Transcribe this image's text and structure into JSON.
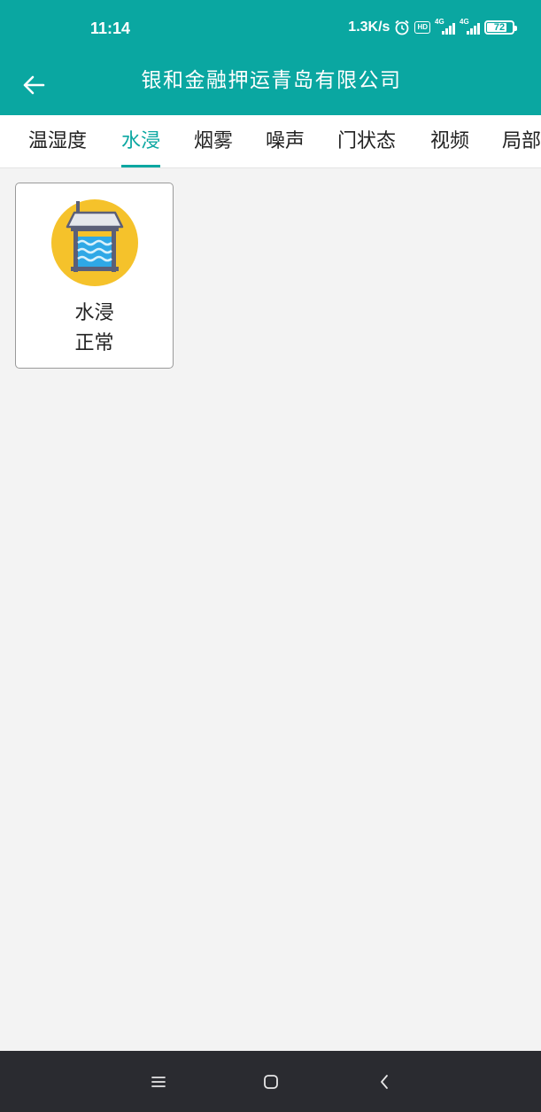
{
  "status_bar": {
    "time": "11:14",
    "speed": "1.3K/s",
    "hd": "HD",
    "net1": "4G",
    "net2": "4G",
    "battery": "72"
  },
  "app_bar": {
    "title": "银和金融押运青岛有限公司",
    "back_icon": "arrow-left-icon"
  },
  "tabs": [
    {
      "label": "温湿度",
      "active": false
    },
    {
      "label": "水浸",
      "active": true
    },
    {
      "label": "烟雾",
      "active": false
    },
    {
      "label": "噪声",
      "active": false
    },
    {
      "label": "门状态",
      "active": false
    },
    {
      "label": "视频",
      "active": false
    },
    {
      "label": "局部",
      "active": false
    }
  ],
  "sensors": [
    {
      "name": "水浸",
      "status": "正常",
      "icon": "water-sensor-icon"
    }
  ],
  "nav_bar": {
    "menu_icon": "menu-icon",
    "home_icon": "home-icon",
    "back_icon": "back-chevron-icon"
  },
  "colors": {
    "primary": "#0aa7a1",
    "icon_bg": "#f5c22b",
    "nav_bar": "#2a2b30"
  }
}
